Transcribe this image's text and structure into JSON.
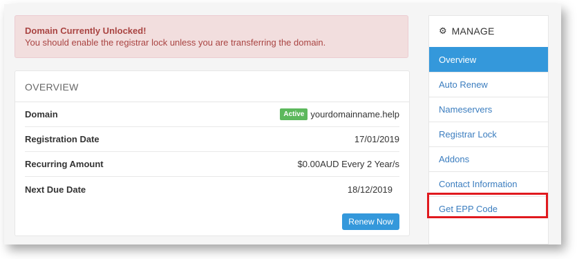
{
  "alert": {
    "title": "Domain Currently Unlocked!",
    "message": "You should enable the registrar lock unless you are transferring the domain."
  },
  "overview": {
    "heading": "OVERVIEW",
    "rows": [
      {
        "label": "Domain",
        "badge": "Active",
        "value": "yourdomainname.help"
      },
      {
        "label": "Registration Date",
        "value": "17/01/2019"
      },
      {
        "label": "Recurring Amount",
        "value": "$0.00AUD Every 2 Year/s"
      },
      {
        "label": "Next Due Date",
        "value": "18/12/2019"
      }
    ],
    "renew_button": "Renew Now"
  },
  "manage": {
    "heading": "MANAGE",
    "items": [
      {
        "label": "Overview",
        "active": true
      },
      {
        "label": "Auto Renew"
      },
      {
        "label": "Nameservers"
      },
      {
        "label": "Registrar Lock"
      },
      {
        "label": "Addons"
      },
      {
        "label": "Contact Information"
      },
      {
        "label": "Get EPP Code",
        "highlighted": true
      }
    ]
  },
  "colors": {
    "alert_bg": "#f2dede",
    "alert_text": "#a94442",
    "accent": "#3498db",
    "link": "#3b7dbf",
    "badge_active": "#5cb85c",
    "highlight": "#e0191e"
  },
  "icons": {
    "manage": "gear-icon"
  }
}
